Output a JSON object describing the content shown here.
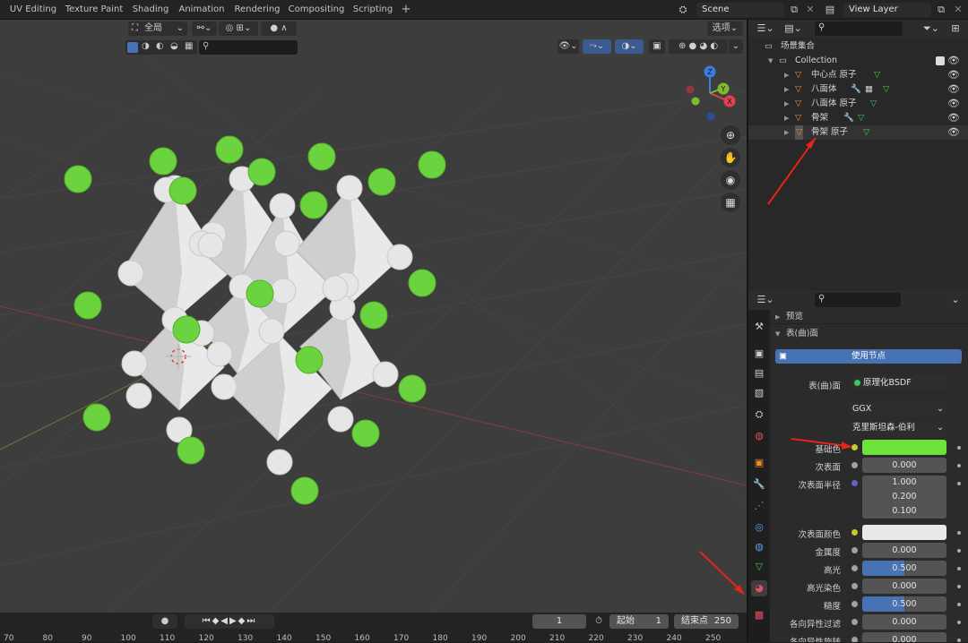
{
  "workspace_tabs": [
    "UV Editing",
    "Texture Paint",
    "Shading",
    "Animation",
    "Rendering",
    "Compositing",
    "Scripting"
  ],
  "add_tab": "+",
  "scene_field": "Scene",
  "view_layer_field": "View Layer",
  "viewport_header": {
    "orientation": "全局",
    "options": "选项"
  },
  "gizmo": {
    "x": "X",
    "y": "Y",
    "z": "Z"
  },
  "outliner": {
    "scene_collection": "场景集合",
    "collection": "Collection",
    "items": [
      {
        "label": "中心点 原子"
      },
      {
        "label": "八面体"
      },
      {
        "label": "八面体 原子"
      },
      {
        "label": "骨架"
      },
      {
        "label": "骨架 原子"
      }
    ]
  },
  "properties": {
    "preview_panel": "预览",
    "surface_panel": "表(曲)面",
    "use_nodes_button": "使用节点",
    "surface_label": "表(曲)面",
    "surface_value": "原理化BSDF",
    "distribution": "GGX",
    "subsurface_method": "克里斯坦森-伯利",
    "rows": [
      {
        "label": "基础色",
        "type": "color",
        "color": "#6be33a"
      },
      {
        "label": "次表面",
        "type": "num",
        "value": "0.000"
      },
      {
        "label": "次表面半径",
        "type": "vec",
        "values": [
          "1.000",
          "0.200",
          "0.100"
        ]
      },
      {
        "label": "次表面颜色",
        "type": "color",
        "color": "#e8e8e8"
      },
      {
        "label": "金属度",
        "type": "num",
        "value": "0.000"
      },
      {
        "label": "高光",
        "type": "num",
        "value": "0.500",
        "fill": 0.5
      },
      {
        "label": "高光染色",
        "type": "num",
        "value": "0.000"
      },
      {
        "label": "糙度",
        "type": "num",
        "value": "0.500",
        "fill": 0.5
      },
      {
        "label": "各向异性过滤",
        "type": "num",
        "value": "0.000"
      },
      {
        "label": "各向异性旋转",
        "type": "num",
        "value": "0.000"
      }
    ]
  },
  "timeline": {
    "current_frame": "1",
    "start_label": "起始",
    "start_value": "1",
    "end_label": "结束点",
    "end_value": "250",
    "ticks": [
      "70",
      "80",
      "90",
      "100",
      "110",
      "120",
      "130",
      "140",
      "150",
      "160",
      "170",
      "180",
      "190",
      "200",
      "210",
      "220",
      "230",
      "240",
      "250"
    ]
  },
  "colors": {
    "green_atom": "#6bd33d",
    "white_atom": "#e6e6e6",
    "accent_blue": "#4772b3",
    "arrow_red": "#e8231a"
  }
}
